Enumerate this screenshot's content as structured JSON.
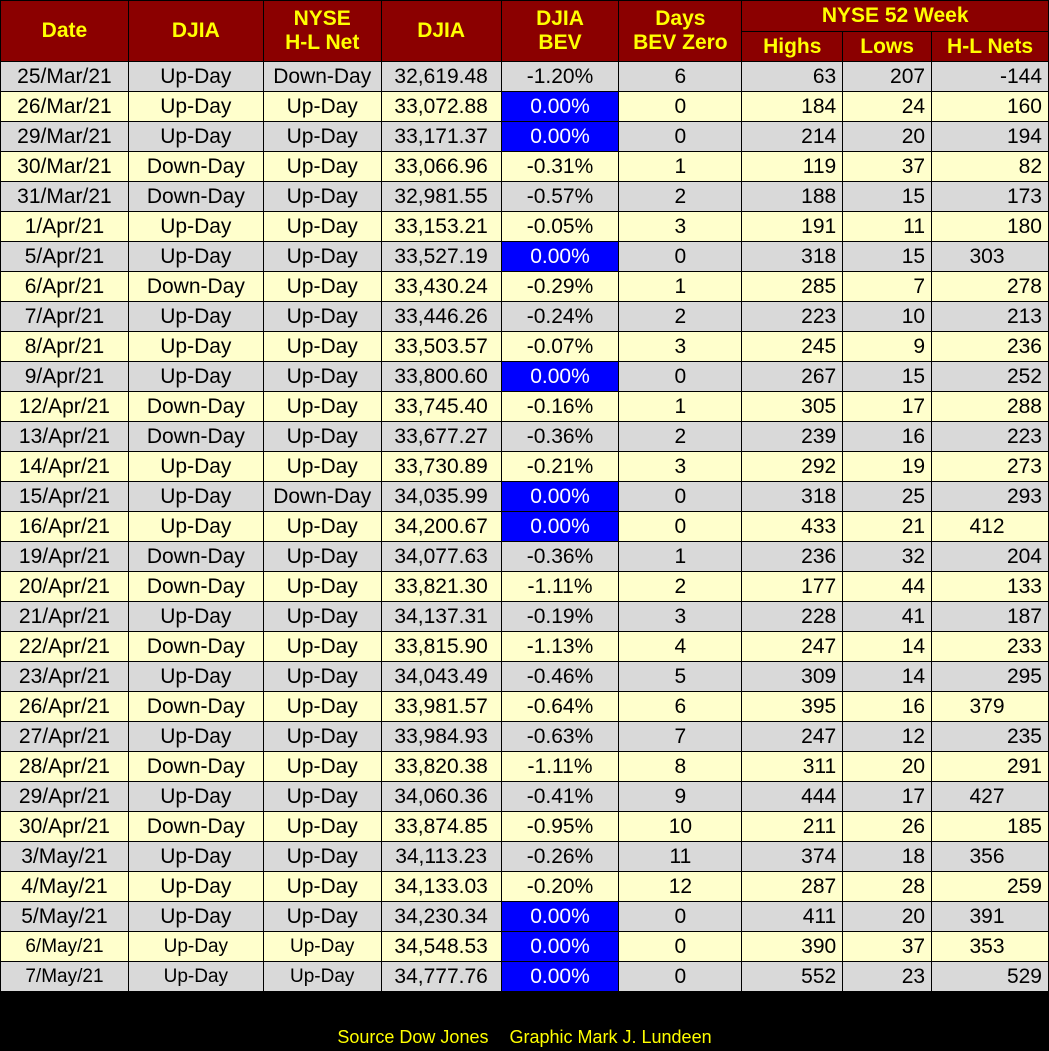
{
  "headers": {
    "date": "Date",
    "djia": "DJIA",
    "nyse_line1": "NYSE",
    "nyse_line2": "H-L Net",
    "djia_close": "DJIA",
    "bev_line1": "DJIA",
    "bev_line2": "BEV",
    "days_line1": "Days",
    "days_line2": "BEV Zero",
    "group": "NYSE 52 Week",
    "highs": "Highs",
    "lows": "Lows",
    "nets": "H-L Nets"
  },
  "rows": [
    {
      "date": "25/Mar/21",
      "djia": "Up-Day",
      "nyse": "Down-Day",
      "close": "32,619.48",
      "bev": "-1.20%",
      "days": "6",
      "highs": "63",
      "lows": "207",
      "nets": "-144"
    },
    {
      "date": "26/Mar/21",
      "djia": "Up-Day",
      "nyse": "Up-Day",
      "close": "33,072.88",
      "bev": "0.00%",
      "days": "0",
      "highs": "184",
      "lows": "24",
      "nets": "160"
    },
    {
      "date": "29/Mar/21",
      "djia": "Up-Day",
      "nyse": "Up-Day",
      "close": "33,171.37",
      "bev": "0.00%",
      "days": "0",
      "highs": "214",
      "lows": "20",
      "nets": "194"
    },
    {
      "date": "30/Mar/21",
      "djia": "Down-Day",
      "nyse": "Up-Day",
      "close": "33,066.96",
      "bev": "-0.31%",
      "days": "1",
      "highs": "119",
      "lows": "37",
      "nets": "82"
    },
    {
      "date": "31/Mar/21",
      "djia": "Down-Day",
      "nyse": "Up-Day",
      "close": "32,981.55",
      "bev": "-0.57%",
      "days": "2",
      "highs": "188",
      "lows": "15",
      "nets": "173"
    },
    {
      "date": "1/Apr/21",
      "djia": "Up-Day",
      "nyse": "Up-Day",
      "close": "33,153.21",
      "bev": "-0.05%",
      "days": "3",
      "highs": "191",
      "lows": "11",
      "nets": "180"
    },
    {
      "date": "5/Apr/21",
      "djia": "Up-Day",
      "nyse": "Up-Day",
      "close": "33,527.19",
      "bev": "0.00%",
      "days": "0",
      "highs": "318",
      "lows": "15",
      "nets": "303"
    },
    {
      "date": "6/Apr/21",
      "djia": "Down-Day",
      "nyse": "Up-Day",
      "close": "33,430.24",
      "bev": "-0.29%",
      "days": "1",
      "highs": "285",
      "lows": "7",
      "nets": "278"
    },
    {
      "date": "7/Apr/21",
      "djia": "Up-Day",
      "nyse": "Up-Day",
      "close": "33,446.26",
      "bev": "-0.24%",
      "days": "2",
      "highs": "223",
      "lows": "10",
      "nets": "213"
    },
    {
      "date": "8/Apr/21",
      "djia": "Up-Day",
      "nyse": "Up-Day",
      "close": "33,503.57",
      "bev": "-0.07%",
      "days": "3",
      "highs": "245",
      "lows": "9",
      "nets": "236"
    },
    {
      "date": "9/Apr/21",
      "djia": "Up-Day",
      "nyse": "Up-Day",
      "close": "33,800.60",
      "bev": "0.00%",
      "days": "0",
      "highs": "267",
      "lows": "15",
      "nets": "252"
    },
    {
      "date": "12/Apr/21",
      "djia": "Down-Day",
      "nyse": "Up-Day",
      "close": "33,745.40",
      "bev": "-0.16%",
      "days": "1",
      "highs": "305",
      "lows": "17",
      "nets": "288"
    },
    {
      "date": "13/Apr/21",
      "djia": "Down-Day",
      "nyse": "Up-Day",
      "close": "33,677.27",
      "bev": "-0.36%",
      "days": "2",
      "highs": "239",
      "lows": "16",
      "nets": "223"
    },
    {
      "date": "14/Apr/21",
      "djia": "Up-Day",
      "nyse": "Up-Day",
      "close": "33,730.89",
      "bev": "-0.21%",
      "days": "3",
      "highs": "292",
      "lows": "19",
      "nets": "273"
    },
    {
      "date": "15/Apr/21",
      "djia": "Up-Day",
      "nyse": "Down-Day",
      "close": "34,035.99",
      "bev": "0.00%",
      "days": "0",
      "highs": "318",
      "lows": "25",
      "nets": "293"
    },
    {
      "date": "16/Apr/21",
      "djia": "Up-Day",
      "nyse": "Up-Day",
      "close": "34,200.67",
      "bev": "0.00%",
      "days": "0",
      "highs": "433",
      "lows": "21",
      "nets": "412"
    },
    {
      "date": "19/Apr/21",
      "djia": "Down-Day",
      "nyse": "Up-Day",
      "close": "34,077.63",
      "bev": "-0.36%",
      "days": "1",
      "highs": "236",
      "lows": "32",
      "nets": "204"
    },
    {
      "date": "20/Apr/21",
      "djia": "Down-Day",
      "nyse": "Up-Day",
      "close": "33,821.30",
      "bev": "-1.11%",
      "days": "2",
      "highs": "177",
      "lows": "44",
      "nets": "133"
    },
    {
      "date": "21/Apr/21",
      "djia": "Up-Day",
      "nyse": "Up-Day",
      "close": "34,137.31",
      "bev": "-0.19%",
      "days": "3",
      "highs": "228",
      "lows": "41",
      "nets": "187"
    },
    {
      "date": "22/Apr/21",
      "djia": "Down-Day",
      "nyse": "Up-Day",
      "close": "33,815.90",
      "bev": "-1.13%",
      "days": "4",
      "highs": "247",
      "lows": "14",
      "nets": "233"
    },
    {
      "date": "23/Apr/21",
      "djia": "Up-Day",
      "nyse": "Up-Day",
      "close": "34,043.49",
      "bev": "-0.46%",
      "days": "5",
      "highs": "309",
      "lows": "14",
      "nets": "295"
    },
    {
      "date": "26/Apr/21",
      "djia": "Down-Day",
      "nyse": "Up-Day",
      "close": "33,981.57",
      "bev": "-0.64%",
      "days": "6",
      "highs": "395",
      "lows": "16",
      "nets": "379"
    },
    {
      "date": "27/Apr/21",
      "djia": "Up-Day",
      "nyse": "Up-Day",
      "close": "33,984.93",
      "bev": "-0.63%",
      "days": "7",
      "highs": "247",
      "lows": "12",
      "nets": "235"
    },
    {
      "date": "28/Apr/21",
      "djia": "Down-Day",
      "nyse": "Up-Day",
      "close": "33,820.38",
      "bev": "-1.11%",
      "days": "8",
      "highs": "311",
      "lows": "20",
      "nets": "291"
    },
    {
      "date": "29/Apr/21",
      "djia": "Up-Day",
      "nyse": "Up-Day",
      "close": "34,060.36",
      "bev": "-0.41%",
      "days": "9",
      "highs": "444",
      "lows": "17",
      "nets": "427"
    },
    {
      "date": "30/Apr/21",
      "djia": "Down-Day",
      "nyse": "Up-Day",
      "close": "33,874.85",
      "bev": "-0.95%",
      "days": "10",
      "highs": "211",
      "lows": "26",
      "nets": "185"
    },
    {
      "date": "3/May/21",
      "djia": "Up-Day",
      "nyse": "Up-Day",
      "close": "34,113.23",
      "bev": "-0.26%",
      "days": "11",
      "highs": "374",
      "lows": "18",
      "nets": "356"
    },
    {
      "date": "4/May/21",
      "djia": "Up-Day",
      "nyse": "Up-Day",
      "close": "34,133.03",
      "bev": "-0.20%",
      "days": "12",
      "highs": "287",
      "lows": "28",
      "nets": "259"
    },
    {
      "date": "5/May/21",
      "djia": "Up-Day",
      "nyse": "Up-Day",
      "close": "34,230.34",
      "bev": "0.00%",
      "days": "0",
      "highs": "411",
      "lows": "20",
      "nets": "391"
    },
    {
      "date": "6/May/21",
      "djia": "Up-Day",
      "nyse": "Up-Day",
      "close": "34,548.53",
      "bev": "0.00%",
      "days": "0",
      "highs": "390",
      "lows": "37",
      "nets": "353"
    },
    {
      "date": "7/May/21",
      "djia": "Up-Day",
      "nyse": "Up-Day",
      "close": "34,777.76",
      "bev": "0.00%",
      "days": "0",
      "highs": "552",
      "lows": "23",
      "nets": "529"
    }
  ],
  "footer": {
    "source": "Source Dow Jones",
    "graphic": "Graphic Mark J. Lundeen"
  },
  "colors": {
    "header_bg": "#8b0000",
    "header_text": "#ffff00",
    "row_gray": "#d9d9d9",
    "row_yellow": "#ffffcc",
    "bev_zero": "#0000ff"
  }
}
